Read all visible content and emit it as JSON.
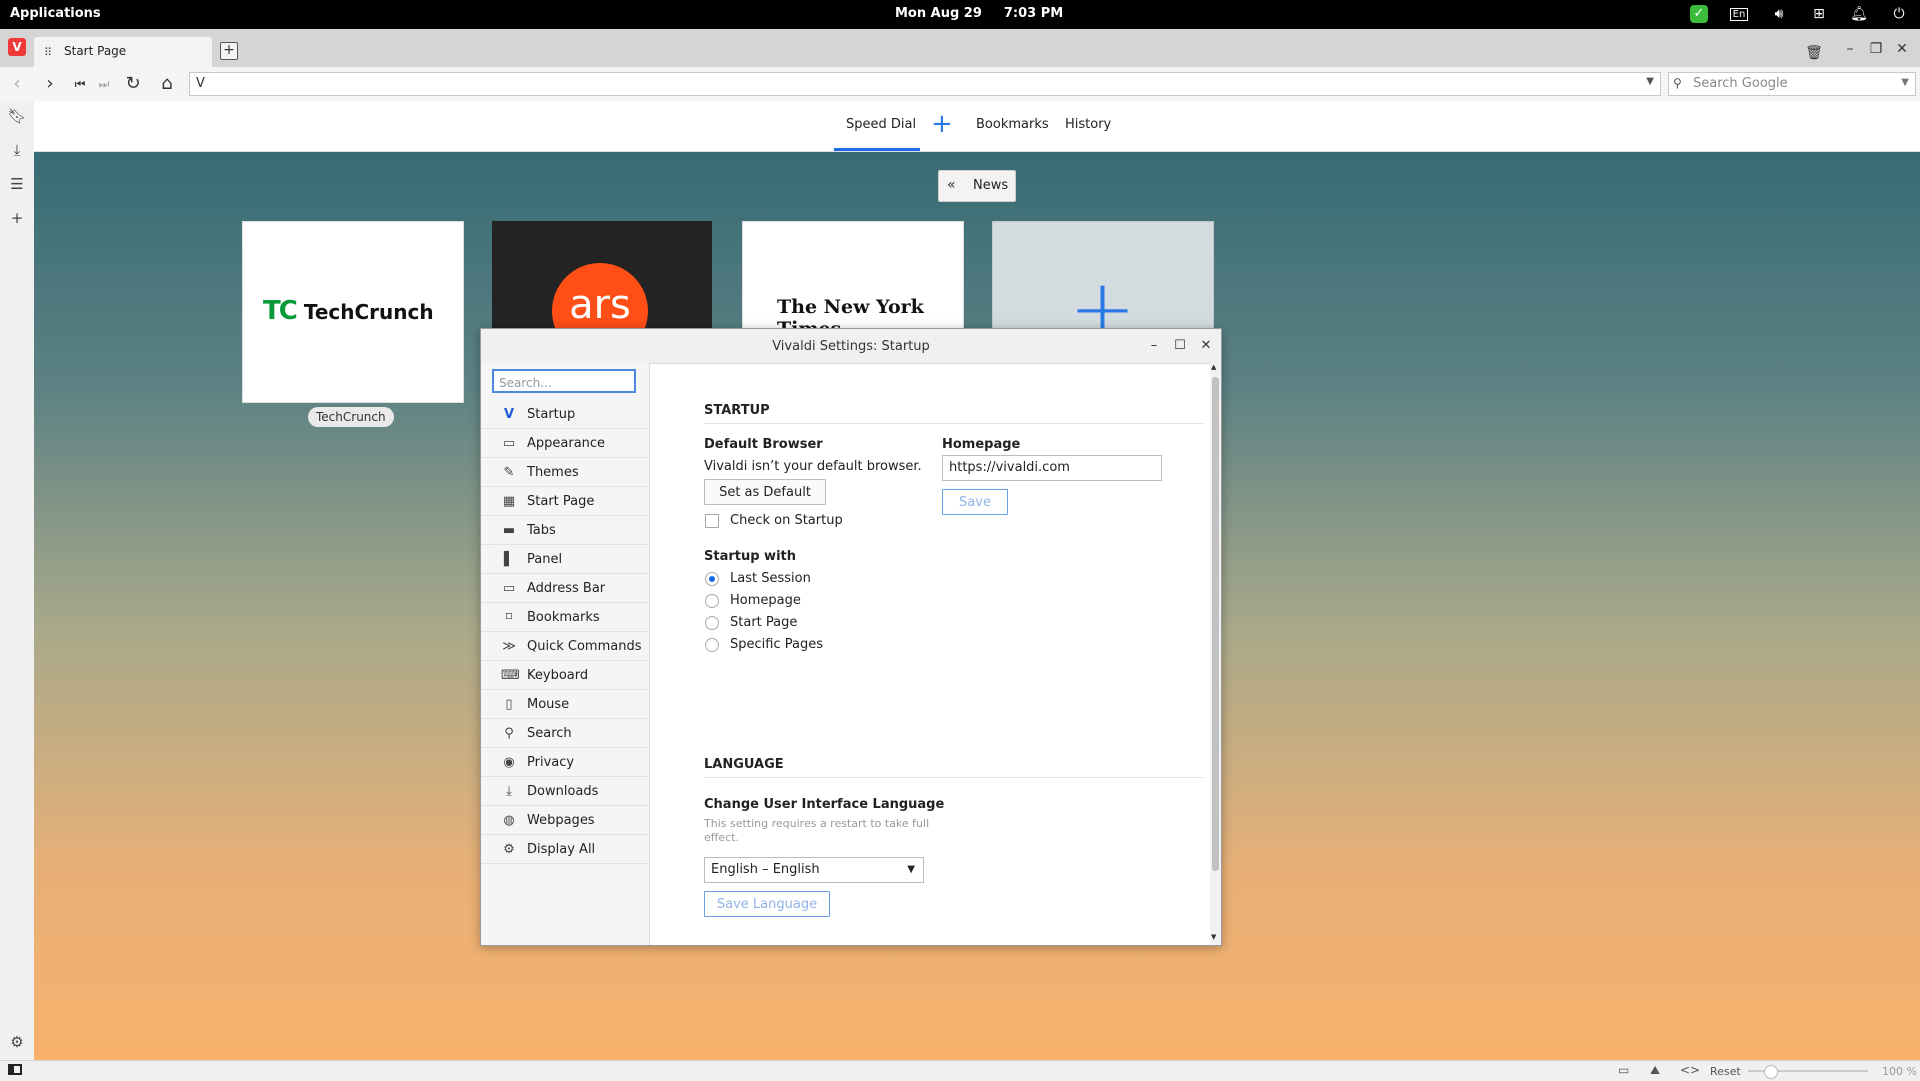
{
  "os": {
    "applications": "Applications",
    "date": "Mon Aug 29",
    "time": "7:03 PM",
    "tray": {
      "keyboard_layout": "En"
    }
  },
  "browser": {
    "tab_title": "Start Page",
    "url_value": "V",
    "search_placeholder": "Search Google",
    "status": {
      "reset": "Reset",
      "zoom": "100 %"
    }
  },
  "start_page": {
    "tabs": [
      "Speed Dial",
      "Bookmarks",
      "History"
    ],
    "news_button": "News",
    "dials": {
      "techcrunch_logo": "TechCrunch",
      "ars_logo": "ars",
      "nyt_logo": "The New York Times",
      "techcrunch_label": "TechCrunch"
    }
  },
  "settings": {
    "window_title": "Vivaldi Settings: Startup",
    "search_placeholder": "Search...",
    "nav": [
      {
        "label": "Startup",
        "icon": "vivaldi-v-icon"
      },
      {
        "label": "Appearance",
        "icon": "window-icon"
      },
      {
        "label": "Themes",
        "icon": "brush-icon"
      },
      {
        "label": "Start Page",
        "icon": "grid-icon"
      },
      {
        "label": "Tabs",
        "icon": "tabs-icon"
      },
      {
        "label": "Panel",
        "icon": "panel-icon"
      },
      {
        "label": "Address Bar",
        "icon": "address-bar-icon"
      },
      {
        "label": "Bookmarks",
        "icon": "bookmark-icon"
      },
      {
        "label": "Quick Commands",
        "icon": "quick-commands-icon"
      },
      {
        "label": "Keyboard",
        "icon": "keyboard-icon"
      },
      {
        "label": "Mouse",
        "icon": "mouse-icon"
      },
      {
        "label": "Search",
        "icon": "magnifier-icon"
      },
      {
        "label": "Privacy",
        "icon": "eye-icon"
      },
      {
        "label": "Downloads",
        "icon": "download-icon"
      },
      {
        "label": "Webpages",
        "icon": "globe-icon"
      },
      {
        "label": "Display All",
        "icon": "gear-icon"
      }
    ],
    "startup": {
      "heading": "STARTUP",
      "default_browser": {
        "heading": "Default Browser",
        "text": "Vivaldi isn’t your default browser.",
        "set_default": "Set as Default",
        "check_on_startup": "Check on Startup"
      },
      "homepage": {
        "heading": "Homepage",
        "value": "https://vivaldi.com",
        "save": "Save"
      },
      "startup_with": {
        "heading": "Startup with",
        "options": [
          "Last Session",
          "Homepage",
          "Start Page",
          "Specific Pages"
        ],
        "selected": "Last Session"
      }
    },
    "language": {
      "heading": "LANGUAGE",
      "sub_heading": "Change User Interface Language",
      "note": "This setting requires a restart to take full effect.",
      "selected": "English – English",
      "save": "Save Language"
    }
  },
  "colors": {
    "accent": "#1e6ce6",
    "vivaldi_red": "#ef3939",
    "ars_orange": "#ff4f16",
    "techcrunch_green": "#0a9a3a"
  }
}
